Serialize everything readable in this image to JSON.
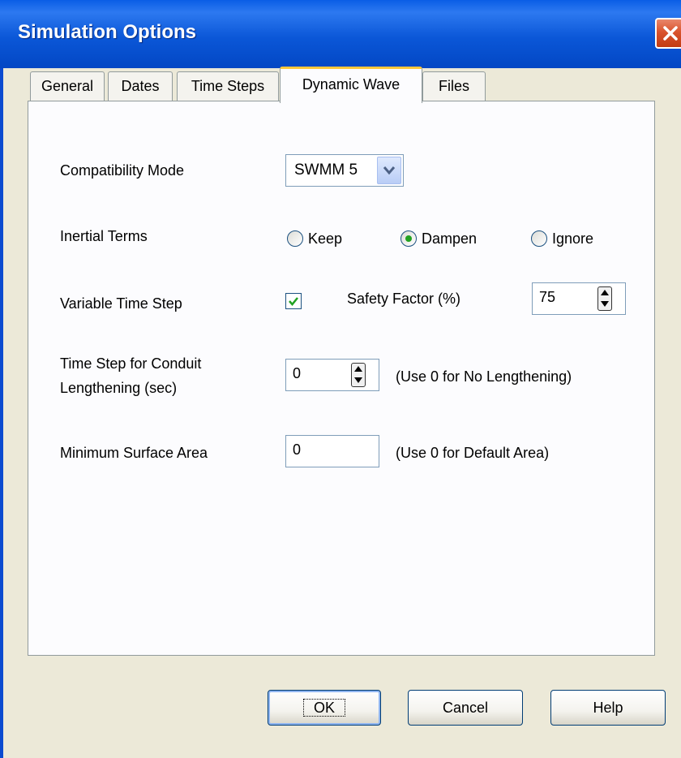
{
  "window": {
    "title": "Simulation Options"
  },
  "tabs": [
    {
      "label": "General"
    },
    {
      "label": "Dates"
    },
    {
      "label": "Time Steps"
    },
    {
      "label": "Dynamic Wave",
      "active": true
    },
    {
      "label": "Files"
    }
  ],
  "form": {
    "compatibility_mode": {
      "label": "Compatibility Mode",
      "value": "SWMM 5"
    },
    "inertial_terms": {
      "label": "Inertial Terms",
      "options": [
        "Keep",
        "Dampen",
        "Ignore"
      ],
      "selected": "Dampen"
    },
    "variable_time_step": {
      "label": "Variable Time Step",
      "checked": true
    },
    "safety_factor": {
      "label": "Safety Factor (%)",
      "value": "75"
    },
    "conduit_lengthening": {
      "label_line1": "Time Step for Conduit",
      "label_line2": "Lengthening (sec)",
      "value": "0",
      "hint": "(Use 0 for No Lengthening)"
    },
    "min_surface_area": {
      "label": "Minimum Surface Area",
      "value": "0",
      "hint": "(Use 0 for Default Area)"
    }
  },
  "buttons": {
    "ok": "OK",
    "cancel": "Cancel",
    "help": "Help"
  },
  "colors": {
    "titlebar": "#0b57d8",
    "accent_tab": "#ffc83c",
    "check": "#21a121",
    "dialog_bg": "#ece9d8"
  }
}
